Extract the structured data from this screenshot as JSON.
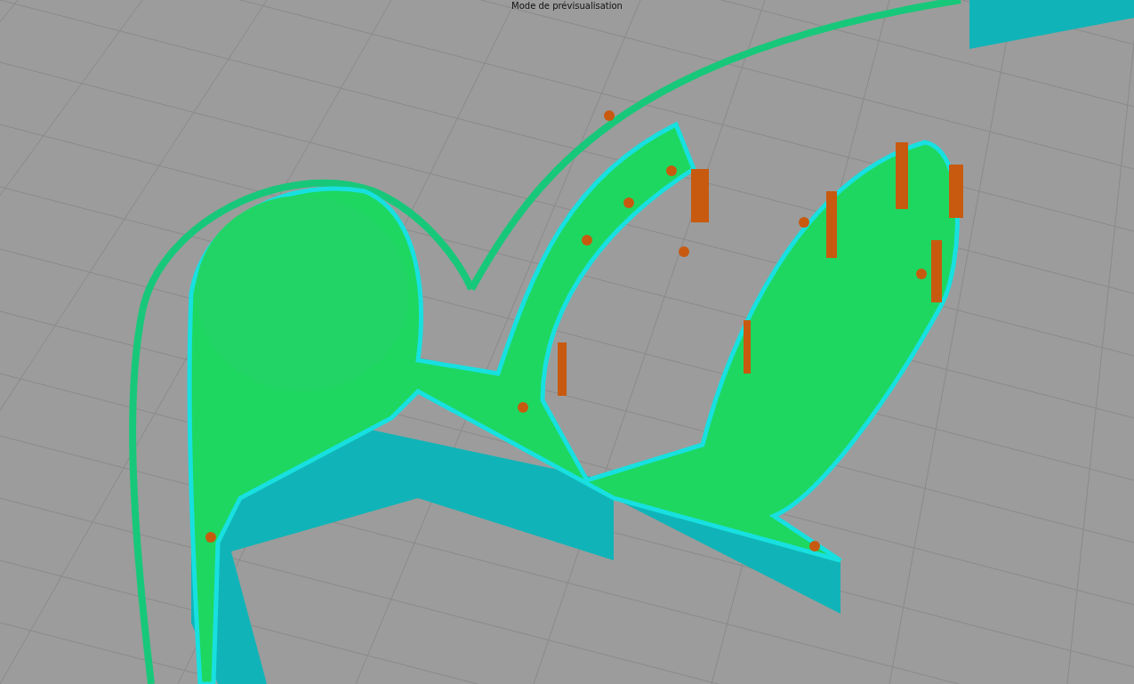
{
  "viewport": {
    "title": "Mode de prévisualisation"
  }
}
